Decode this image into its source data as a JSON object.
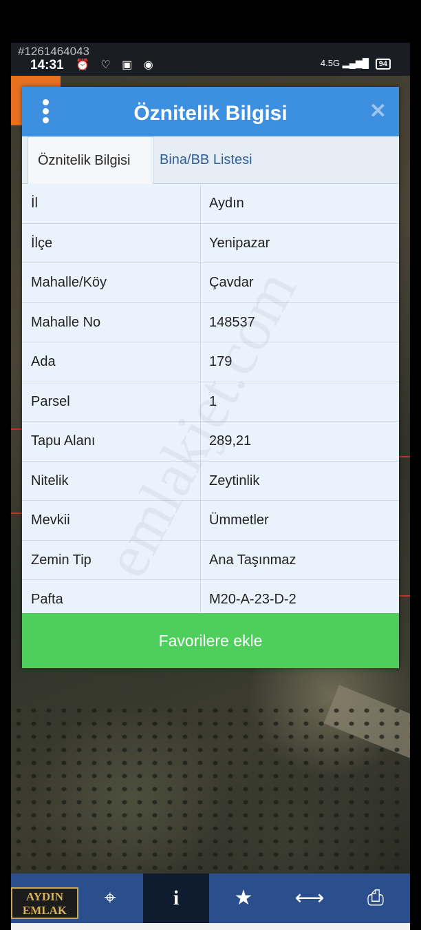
{
  "statusbar": {
    "ad_id": "#1261464043",
    "time": "14:31",
    "icons": "⏰ ♡ ▣ ◉",
    "network": "4.5G ▂▄▆█",
    "battery": "94"
  },
  "dialog": {
    "title": "Öznitelik Bilgisi",
    "close": "✕",
    "tabs": [
      {
        "label": "Öznitelik Bilgisi"
      },
      {
        "label": "Bina/BB Listesi"
      }
    ],
    "rows": [
      {
        "key": "İl",
        "value": "Aydın"
      },
      {
        "key": "İlçe",
        "value": "Yenipazar"
      },
      {
        "key": "Mahalle/Köy",
        "value": "Çavdar"
      },
      {
        "key": "Mahalle No",
        "value": "148537"
      },
      {
        "key": "Ada",
        "value": "179"
      },
      {
        "key": "Parsel",
        "value": "1"
      },
      {
        "key": "Tapu Alanı",
        "value": "289,21"
      },
      {
        "key": "Nitelik",
        "value": "Zeytinlik"
      },
      {
        "key": "Mevkii",
        "value": "Ümmetler"
      },
      {
        "key": "Zemin Tip",
        "value": "Ana Taşınmaz"
      },
      {
        "key": "Pafta",
        "value": "M20-A-23-D-2"
      }
    ],
    "favorite_button": "Favorilere ekle",
    "watermark": "emlakjet.com"
  },
  "toolbar": {
    "buttons": [
      {
        "icon": "refresh-icon",
        "glyph": "⟳"
      },
      {
        "icon": "locate-icon",
        "glyph": "⌖"
      },
      {
        "icon": "info-icon",
        "glyph": "i"
      },
      {
        "icon": "star-icon",
        "glyph": "★"
      },
      {
        "icon": "measure-icon",
        "glyph": "⟷"
      },
      {
        "icon": "print-icon",
        "glyph": "⎙"
      }
    ],
    "active_index": 2
  },
  "logo": {
    "line1": "AYDIN",
    "line2": "EMLAK"
  },
  "colors": {
    "header": "#3d8fe0",
    "favorite": "#4ecf5c",
    "toolbar": "#2b4f8c"
  }
}
